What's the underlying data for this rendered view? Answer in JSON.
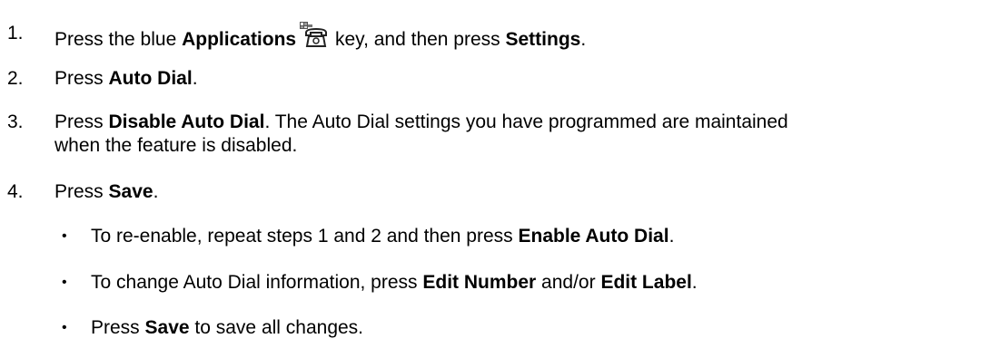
{
  "steps": [
    {
      "number": "1.",
      "t1": "Press the blue ",
      "b1": "Applications",
      "icon": "applications-phone-icon",
      "t2": " key, and then press ",
      "b2": "Settings",
      "t3": "."
    },
    {
      "number": "2.",
      "t1": "Press ",
      "b1": "Auto Dial",
      "t2": "."
    },
    {
      "number": "3.",
      "t1": "Press ",
      "b1": "Disable Auto Dial",
      "t2": ". The Auto Dial settings you have programmed are maintained",
      "line2": "when the feature is disabled."
    },
    {
      "number": "4.",
      "t1": "Press ",
      "b1": "Save",
      "t2": "."
    }
  ],
  "bullets": [
    {
      "symbol": "•",
      "t1": "To re-enable, repeat steps 1 and 2 and then press ",
      "b1": "Enable Auto Dial",
      "t2": "."
    },
    {
      "symbol": "•",
      "t1": "To change Auto Dial information, press ",
      "b1": "Edit Number",
      "t2": " and/or ",
      "b2": "Edit Label",
      "t3": "."
    },
    {
      "symbol": "•",
      "t1": "Press ",
      "b1": "Save",
      "t2": " to save all changes."
    }
  ]
}
